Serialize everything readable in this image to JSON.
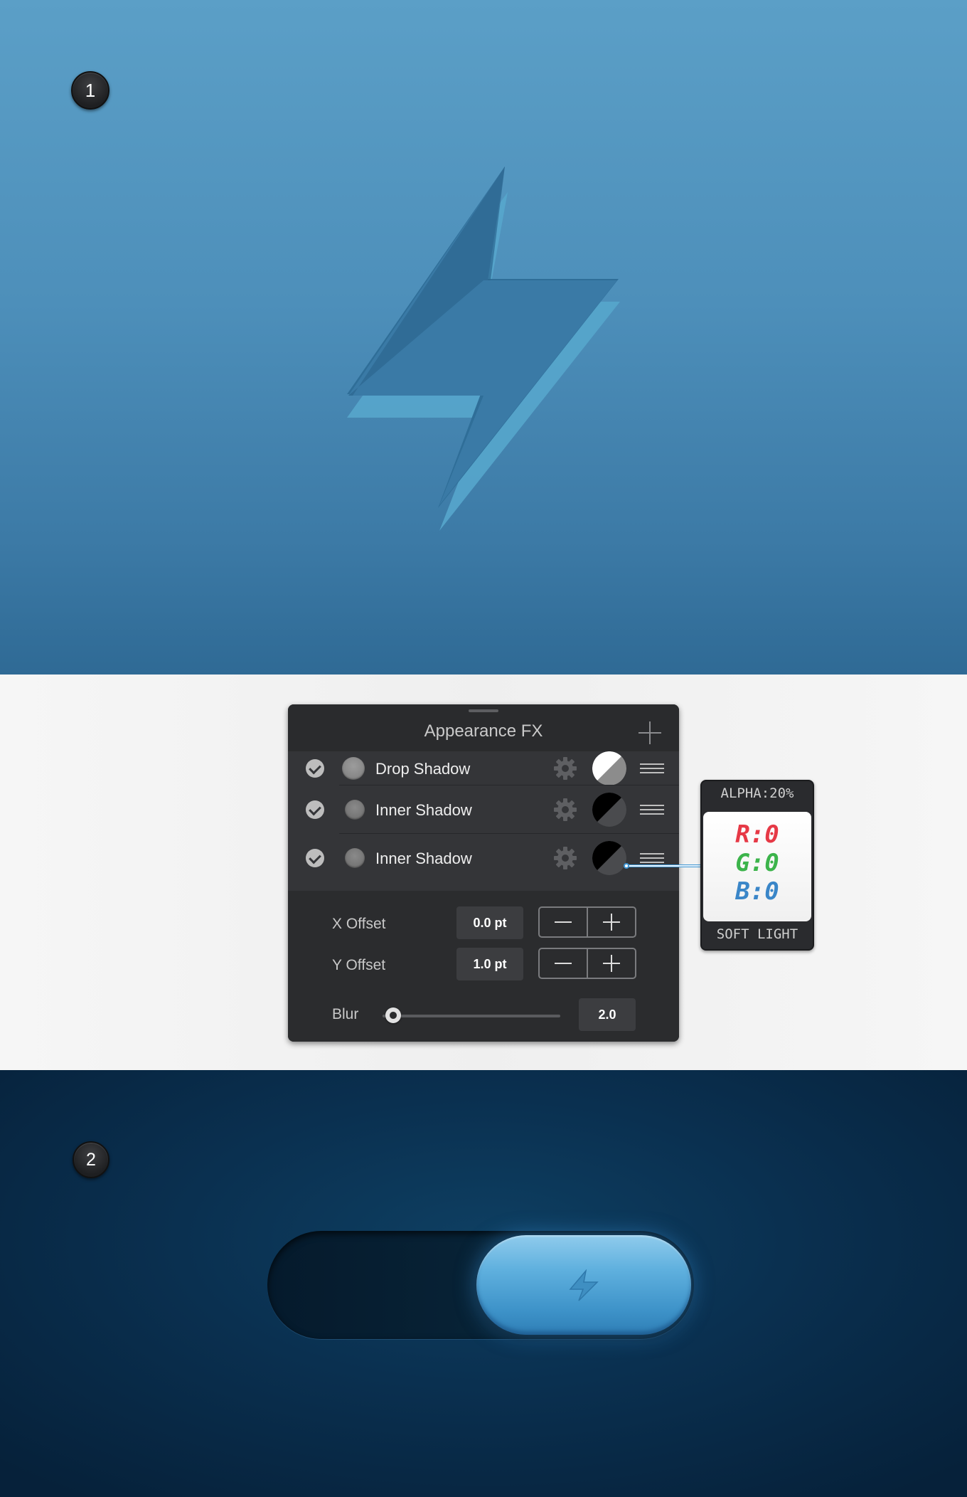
{
  "step1": {
    "number": "1"
  },
  "step2": {
    "number": "2"
  },
  "panel": {
    "title": "Appearance FX",
    "effects": [
      {
        "label": "Drop Shadow"
      },
      {
        "label": "Inner Shadow"
      },
      {
        "label": "Inner Shadow"
      }
    ],
    "x_offset": {
      "label": "X Offset",
      "value": "0.0 pt"
    },
    "y_offset": {
      "label": "Y Offset",
      "value": "1.0 pt"
    },
    "blur": {
      "label": "Blur",
      "value": "2.0",
      "slider_fraction": 0.06
    }
  },
  "tooltip": {
    "alpha": "ALPHA:20%",
    "r": "R:0",
    "g": "G:0",
    "b": "B:0",
    "blend": "SOFT LIGHT",
    "colors": {
      "r": "#e63946",
      "g": "#3cb44b",
      "b": "#3a86c8"
    }
  },
  "colors": {
    "bg_top": "#5b9fc7",
    "bg_dark": "#06213a",
    "accent_blue": "#5fb0de",
    "panel_bg": "#2b2c2e"
  },
  "icons": [
    "lightning-icon",
    "plus-icon",
    "check-icon",
    "gear-icon",
    "blend-mode-icon",
    "menu-icon",
    "minus-icon"
  ]
}
